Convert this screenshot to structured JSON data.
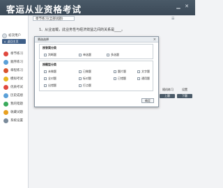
{
  "app": {
    "title": "客运从业资格考试"
  },
  "sidebar": {
    "user_label": "初次用户",
    "back_label": "返回主页",
    "items": [
      {
        "label": "章节练习",
        "icon": "pencil-icon",
        "color": "#e0483e"
      },
      {
        "label": "顺序练习",
        "icon": "list-icon",
        "color": "#5aa0d8"
      },
      {
        "label": "章程练习",
        "icon": "book-icon",
        "color": "#d9532c"
      },
      {
        "label": "模拟考试",
        "icon": "exam-icon",
        "color": "#e8b820"
      },
      {
        "label": "优质考试",
        "icon": "star-icon",
        "color": "#e0483e"
      },
      {
        "label": "历史成绩",
        "icon": "history-icon",
        "color": "#5aa0d8"
      },
      {
        "label": "我的错题",
        "icon": "error-icon",
        "color": "#3aaa5c"
      },
      {
        "label": "收藏试题",
        "icon": "favorite-icon",
        "color": "#e8a020"
      },
      {
        "label": "系统设置",
        "icon": "settings-icon",
        "color": "#7a8a9a"
      }
    ]
  },
  "main": {
    "chapter_select": "章节练习(全部试题)",
    "question_text": "1、从业运载，此业务性与经济效益之间的关系是____。",
    "side_buttons": [
      "随机练习",
      "设置",
      "上题",
      "下题"
    ]
  },
  "dialog": {
    "title": "筛选选择",
    "close": "×",
    "group1": {
      "label": "按答案分类",
      "options": [
        "判断题",
        "单选题",
        "多选题"
      ]
    },
    "group2": {
      "label": "按题型分类",
      "options": [
        "未做题",
        "已做题",
        "题片题",
        "文字题",
        "全对题",
        "标对题",
        "已错题",
        "通用题",
        "出错题",
        "打点题"
      ]
    },
    "ok": "确定"
  }
}
